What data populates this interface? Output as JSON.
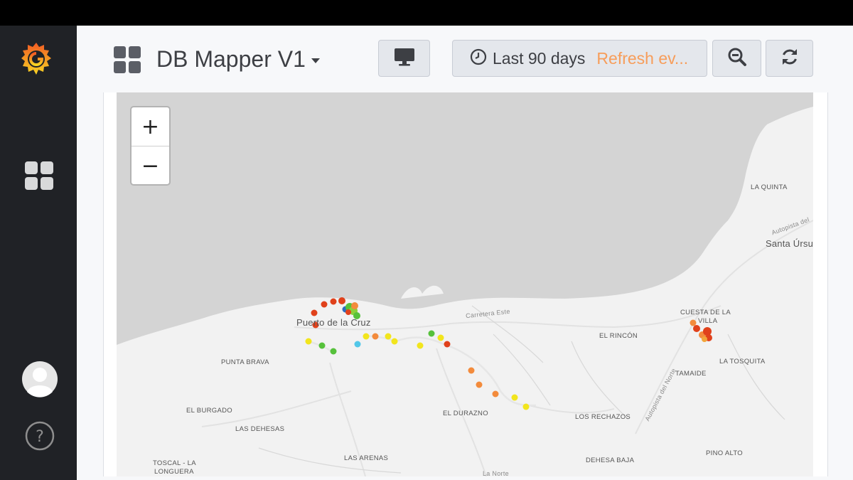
{
  "dashboard": {
    "title": "DB Mapper V1",
    "time_range": "Last 90 days",
    "refresh_label": "Refresh ev..."
  },
  "sidebar": {
    "items": [
      {
        "icon": "grafana-logo-icon"
      },
      {
        "icon": "dashboards-icon"
      },
      {
        "icon": "user-avatar-icon"
      },
      {
        "icon": "help-icon"
      }
    ]
  },
  "toolbar": {
    "buttons": [
      {
        "icon": "tv-icon"
      },
      {
        "icon": "clock-icon"
      },
      {
        "icon": "zoom-out-icon"
      },
      {
        "icon": "refresh-icon"
      }
    ]
  },
  "map": {
    "zoom_in_label": "+",
    "zoom_out_label": "−",
    "places": [
      {
        "name": "LA QUINTA"
      },
      {
        "name": "Autopista del"
      },
      {
        "name": "Santa Úrsu"
      },
      {
        "name": "CUESTA DE LA"
      },
      {
        "name": "VILLA"
      },
      {
        "name": "Carretera Este"
      },
      {
        "name": "Puerto de la Cruz"
      },
      {
        "name": "EL RINCÓN"
      },
      {
        "name": "PUNTA BRAVA"
      },
      {
        "name": "LA TOSQUITA"
      },
      {
        "name": "TAMAIDE"
      },
      {
        "name": "Autopista del Norte"
      },
      {
        "name": "EL BURGADO"
      },
      {
        "name": "EL DURAZNO"
      },
      {
        "name": "LOS RECHAZOS"
      },
      {
        "name": "LAS DEHESAS"
      },
      {
        "name": "PINO ALTO"
      },
      {
        "name": "TOSCAL - LA"
      },
      {
        "name": "LONGUERA"
      },
      {
        "name": "LAS ARENAS"
      },
      {
        "name": "DEHESA BAJA"
      },
      {
        "name": "La Norte"
      }
    ]
  },
  "colors": {
    "sidebar_bg": "#202226",
    "accent_orange": "#f79d5a",
    "sea": "#d4d4d4",
    "land": "#f2f2f2",
    "marker_red": "#e0411b",
    "marker_orange": "#f38b3c",
    "marker_yellow": "#f2e51d",
    "marker_green": "#56c13b",
    "marker_cyan": "#52c7e8"
  }
}
